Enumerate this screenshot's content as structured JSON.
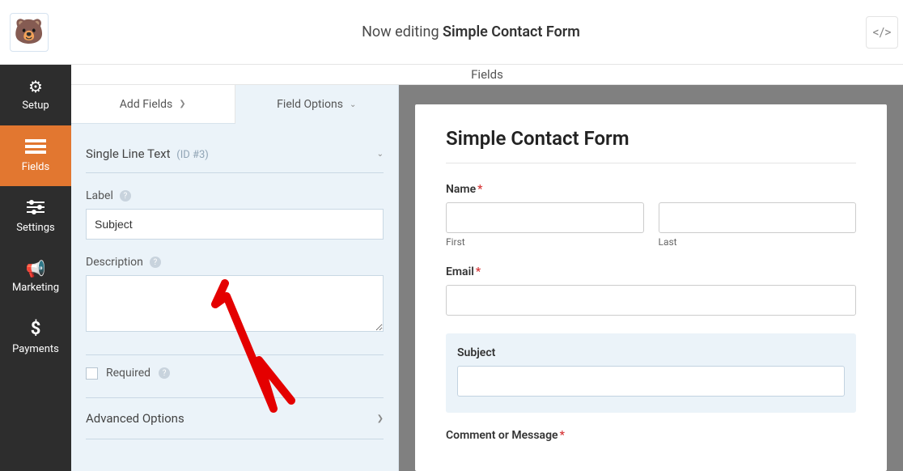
{
  "header": {
    "editing_prefix": "Now editing",
    "form_name": "Simple Contact Form"
  },
  "nav": {
    "setup": "Setup",
    "fields": "Fields",
    "settings": "Settings",
    "marketing": "Marketing",
    "payments": "Payments"
  },
  "titlebar": "Fields",
  "side": {
    "tab_add": "Add Fields",
    "tab_options": "Field Options",
    "field_type": "Single Line Text",
    "field_id": "(ID #3)",
    "label_label": "Label",
    "label_value": "Subject",
    "description_label": "Description",
    "description_value": "",
    "required_label": "Required",
    "advanced_label": "Advanced Options"
  },
  "preview": {
    "title": "Simple Contact Form",
    "name_label": "Name",
    "first_label": "First",
    "last_label": "Last",
    "email_label": "Email",
    "subject_label": "Subject",
    "comment_label": "Comment or Message"
  }
}
